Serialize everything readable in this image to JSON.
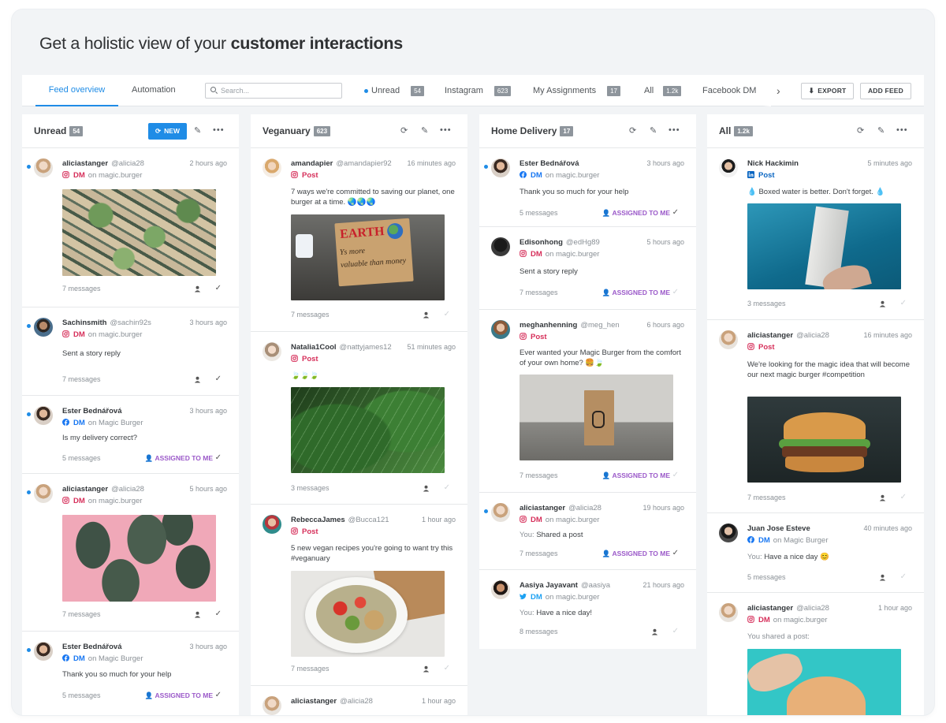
{
  "headline": {
    "prefix": "Get a holistic view of your",
    "bold": "customer interactions"
  },
  "nav": {
    "tabs": [
      {
        "label": "Feed overview"
      },
      {
        "label": "Automation"
      }
    ],
    "search_placeholder": "Search...",
    "feeds": [
      {
        "label": "Unread",
        "count": "54"
      },
      {
        "label": "Instagram",
        "count": "623"
      },
      {
        "label": "My Assignments",
        "count": "17"
      },
      {
        "label": "All",
        "count": "1.2k"
      },
      {
        "label": "Facebook DM",
        "count": ""
      }
    ],
    "chevron": "›",
    "export_label": "EXPORT",
    "add_feed_label": "ADD FEED"
  },
  "columns": [
    {
      "title": "Unread",
      "count": "54",
      "new_label": "NEW",
      "cards": [
        {
          "user": "aliciastanger",
          "handle": "@alicia28",
          "time": "2 hours ago",
          "platform": "instagram",
          "type": "DM",
          "on": "on magic.burger",
          "text": "",
          "footer": "7 messages",
          "assigned": "",
          "unread": true
        },
        {
          "user": "Sachinsmith",
          "handle": "@sachin92s",
          "time": "3 hours ago",
          "platform": "instagram",
          "type": "DM",
          "on": "on magic.burger",
          "text": "Sent a story reply",
          "footer": "7 messages",
          "assigned": "",
          "unread": true
        },
        {
          "user": "Ester Bednářová",
          "handle": "",
          "time": "3 hours ago",
          "platform": "facebook",
          "type": "DM",
          "on": "on Magic Burger",
          "text": "Is my delivery correct?",
          "footer": "5 messages",
          "assigned": "ASSIGNED TO ME",
          "unread": true
        },
        {
          "user": "aliciastanger",
          "handle": "@alicia28",
          "time": "5 hours ago",
          "platform": "instagram",
          "type": "DM",
          "on": "on magic.burger",
          "text": "",
          "footer": "7 messages",
          "assigned": "",
          "unread": true
        },
        {
          "user": "Ester Bednářová",
          "handle": "",
          "time": "3 hours ago",
          "platform": "facebook",
          "type": "DM",
          "on": "on Magic Burger",
          "text": "Thank you so much for your help",
          "footer": "5 messages",
          "assigned": "ASSIGNED TO ME",
          "unread": true
        }
      ]
    },
    {
      "title": "Veganuary",
      "count": "623",
      "cards": [
        {
          "user": "amandapier",
          "handle": "@amandapier92",
          "time": "16 minutes ago",
          "platform": "instagram",
          "type": "Post",
          "on": "",
          "text": "7 ways we're committed to saving our planet, one burger at a time. 🌏🌏🌏",
          "footer": "7 messages",
          "assigned": ""
        },
        {
          "user": "Natalia1Cool",
          "handle": "@nattyjames12",
          "time": "51 minutes ago",
          "platform": "instagram",
          "type": "Post",
          "on": "",
          "text": "🍃🍃🍃",
          "footer": "3 messages",
          "assigned": ""
        },
        {
          "user": "RebeccaJames",
          "handle": "@Bucca121",
          "time": "1 hour ago",
          "platform": "instagram",
          "type": "Post",
          "on": "",
          "text": "5 new vegan recipes you're going to want try this #veganuary",
          "footer": "7 messages",
          "assigned": ""
        },
        {
          "user": "aliciastanger",
          "handle": "@alicia28",
          "time": "1 hour ago",
          "platform": "instagram",
          "type": "",
          "on": "",
          "text": "",
          "footer": "",
          "assigned": ""
        }
      ]
    },
    {
      "title": "Home Delivery",
      "count": "17",
      "cards": [
        {
          "user": "Ester Bednářová",
          "handle": "",
          "time": "3 hours ago",
          "platform": "facebook",
          "type": "DM",
          "on": "on magic.burger",
          "text": "Thank you so much for your help",
          "footer": "5 messages",
          "assigned": "ASSIGNED TO ME",
          "unread": true
        },
        {
          "user": "Edisonhong",
          "handle": "@edHg89",
          "time": "5 hours ago",
          "platform": "instagram",
          "type": "DM",
          "on": "on magic.burger",
          "text": "Sent a story reply",
          "footer": "7 messages",
          "assigned": "ASSIGNED TO ME"
        },
        {
          "user": "meghanhenning",
          "handle": "@meg_hen",
          "time": "6 hours ago",
          "platform": "instagram",
          "type": "Post",
          "on": "",
          "text": "Ever wanted your Magic Burger from the comfort of your own home? 🍔🍃",
          "footer": "7 messages",
          "assigned": "ASSIGNED TO ME"
        },
        {
          "user": "aliciastanger",
          "handle": "@alicia28",
          "time": "19 hours ago",
          "platform": "instagram",
          "type": "DM",
          "on": "on magic.burger",
          "you": "You:",
          "text": "Shared a post",
          "footer": "7 messages",
          "assigned": "ASSIGNED TO ME",
          "unread": true
        },
        {
          "user": "Aasiya Jayavant",
          "handle": "@aasiya",
          "time": "21 hours ago",
          "platform": "twitter",
          "type": "DM",
          "on": "on magic.burger",
          "you": "You:",
          "text": "Have a nice day!",
          "footer": "8 messages",
          "assigned": ""
        }
      ]
    },
    {
      "title": "All",
      "count": "1.2k",
      "cards": [
        {
          "user": "Nick Hackimin",
          "handle": "",
          "time": "5 minutes ago",
          "platform": "linkedin",
          "type": "Post",
          "on": "",
          "text": "💧 Boxed water is better. Don't forget. 💧",
          "footer": "3 messages",
          "assigned": ""
        },
        {
          "user": "aliciastanger",
          "handle": "@alicia28",
          "time": "16 minutes ago",
          "platform": "instagram",
          "type": "Post",
          "on": "",
          "text": "We're looking for the magic idea that will become our next magic burger #competition",
          "footer": "7 messages",
          "assigned": ""
        },
        {
          "user": "Juan Jose Esteve",
          "handle": "",
          "time": "40 minutes ago",
          "platform": "facebook",
          "type": "DM",
          "on": "on Magic Burger",
          "you": "You:",
          "text": "Have a nice day 😊",
          "footer": "5 messages",
          "assigned": ""
        },
        {
          "user": "aliciastanger",
          "handle": "@alicia28",
          "time": "1 hour ago",
          "platform": "instagram",
          "type": "DM",
          "on": "on magic.burger",
          "text": "You shared a post:",
          "footer": "",
          "assigned": ""
        }
      ]
    }
  ],
  "colors": {
    "accent": "#1f8ce6",
    "instagram": "#d62f5a",
    "facebook": "#1877f2",
    "assigned": "#9b59c9"
  }
}
